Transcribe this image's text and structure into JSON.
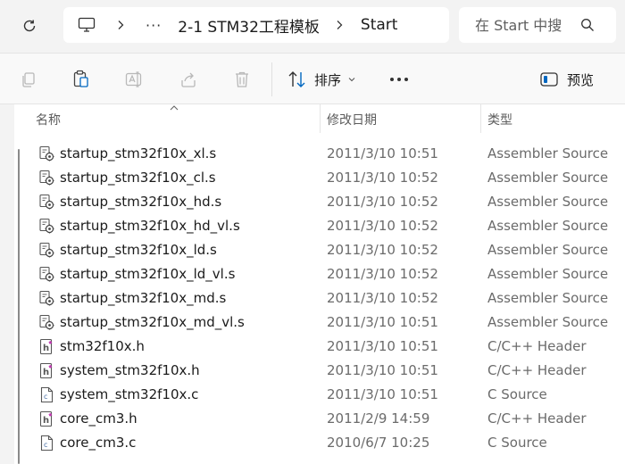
{
  "address": {
    "breadcrumbs": [
      "2-1 STM32工程模板",
      "Start"
    ],
    "overflow_label": "···"
  },
  "search": {
    "placeholder": "在 Start 中搜"
  },
  "toolbar": {
    "sort_label": "排序",
    "more_label": "•••",
    "preview_label": "预览"
  },
  "columns": {
    "name": "名称",
    "date": "修改日期",
    "type": "类型"
  },
  "files": [
    {
      "name": "startup_stm32f10x_xl.s",
      "date": "2011/3/10 10:51",
      "type": "Assembler Source",
      "icon": "asm"
    },
    {
      "name": "startup_stm32f10x_cl.s",
      "date": "2011/3/10 10:52",
      "type": "Assembler Source",
      "icon": "asm"
    },
    {
      "name": "startup_stm32f10x_hd.s",
      "date": "2011/3/10 10:52",
      "type": "Assembler Source",
      "icon": "asm"
    },
    {
      "name": "startup_stm32f10x_hd_vl.s",
      "date": "2011/3/10 10:52",
      "type": "Assembler Source",
      "icon": "asm"
    },
    {
      "name": "startup_stm32f10x_ld.s",
      "date": "2011/3/10 10:52",
      "type": "Assembler Source",
      "icon": "asm"
    },
    {
      "name": "startup_stm32f10x_ld_vl.s",
      "date": "2011/3/10 10:52",
      "type": "Assembler Source",
      "icon": "asm"
    },
    {
      "name": "startup_stm32f10x_md.s",
      "date": "2011/3/10 10:52",
      "type": "Assembler Source",
      "icon": "asm"
    },
    {
      "name": "startup_stm32f10x_md_vl.s",
      "date": "2011/3/10 10:51",
      "type": "Assembler Source",
      "icon": "asm"
    },
    {
      "name": "stm32f10x.h",
      "date": "2011/3/10 10:51",
      "type": "C/C++ Header",
      "icon": "header"
    },
    {
      "name": "system_stm32f10x.h",
      "date": "2011/3/10 10:51",
      "type": "C/C++ Header",
      "icon": "header"
    },
    {
      "name": "system_stm32f10x.c",
      "date": "2011/3/10 10:51",
      "type": "C Source",
      "icon": "csource"
    },
    {
      "name": "core_cm3.h",
      "date": "2011/2/9 14:59",
      "type": "C/C++ Header",
      "icon": "header"
    },
    {
      "name": "core_cm3.c",
      "date": "2010/6/7 10:25",
      "type": "C Source",
      "icon": "csource"
    }
  ],
  "colors": {
    "accent": "#0067c0",
    "header_icon": "#c239b3",
    "csource_icon": "#4a6fa5"
  }
}
